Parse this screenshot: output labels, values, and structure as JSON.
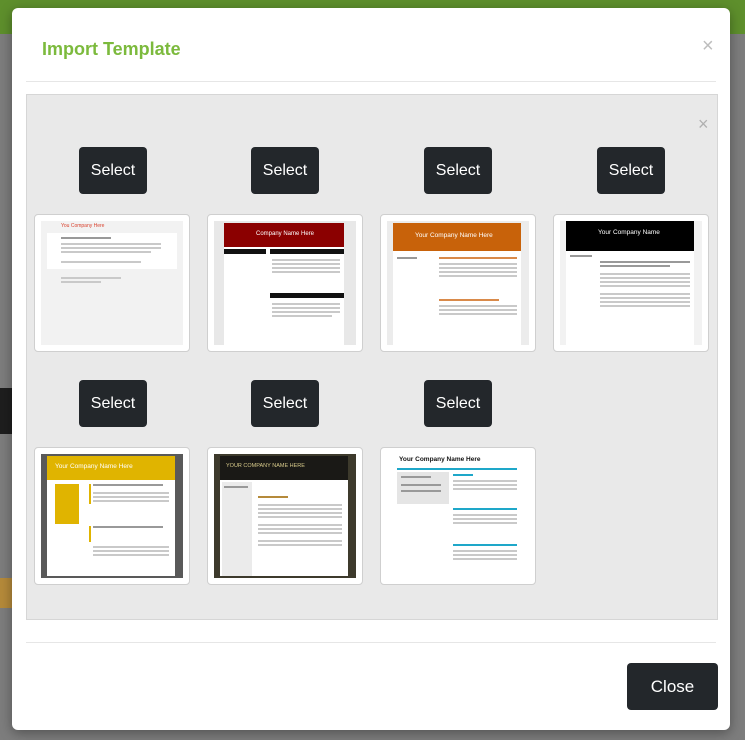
{
  "modal": {
    "title": "Import Template",
    "close_glyph": "×",
    "panel_close_glyph": "×",
    "close_button_label": "Close"
  },
  "templates": [
    {
      "select_label": "Select",
      "company": "You Company Here"
    },
    {
      "select_label": "Select",
      "company": "Company Name Here"
    },
    {
      "select_label": "Select",
      "company": "Your Company Name Here"
    },
    {
      "select_label": "Select",
      "company": "Your Company Name"
    },
    {
      "select_label": "Select",
      "company": "Your Company Name Here"
    },
    {
      "select_label": "Select",
      "company": "YOUR COMPANY NAME HERE"
    },
    {
      "select_label": "Select",
      "company": "Your Company Name Here"
    }
  ],
  "colors": {
    "accent_green": "#7cba3d",
    "button_dark": "#23272b",
    "t2_header": "#8b0000",
    "t3_header": "#c8620a",
    "t4_header": "#000000",
    "t5_header": "#e0b400",
    "t6_header": "#2a2822"
  }
}
